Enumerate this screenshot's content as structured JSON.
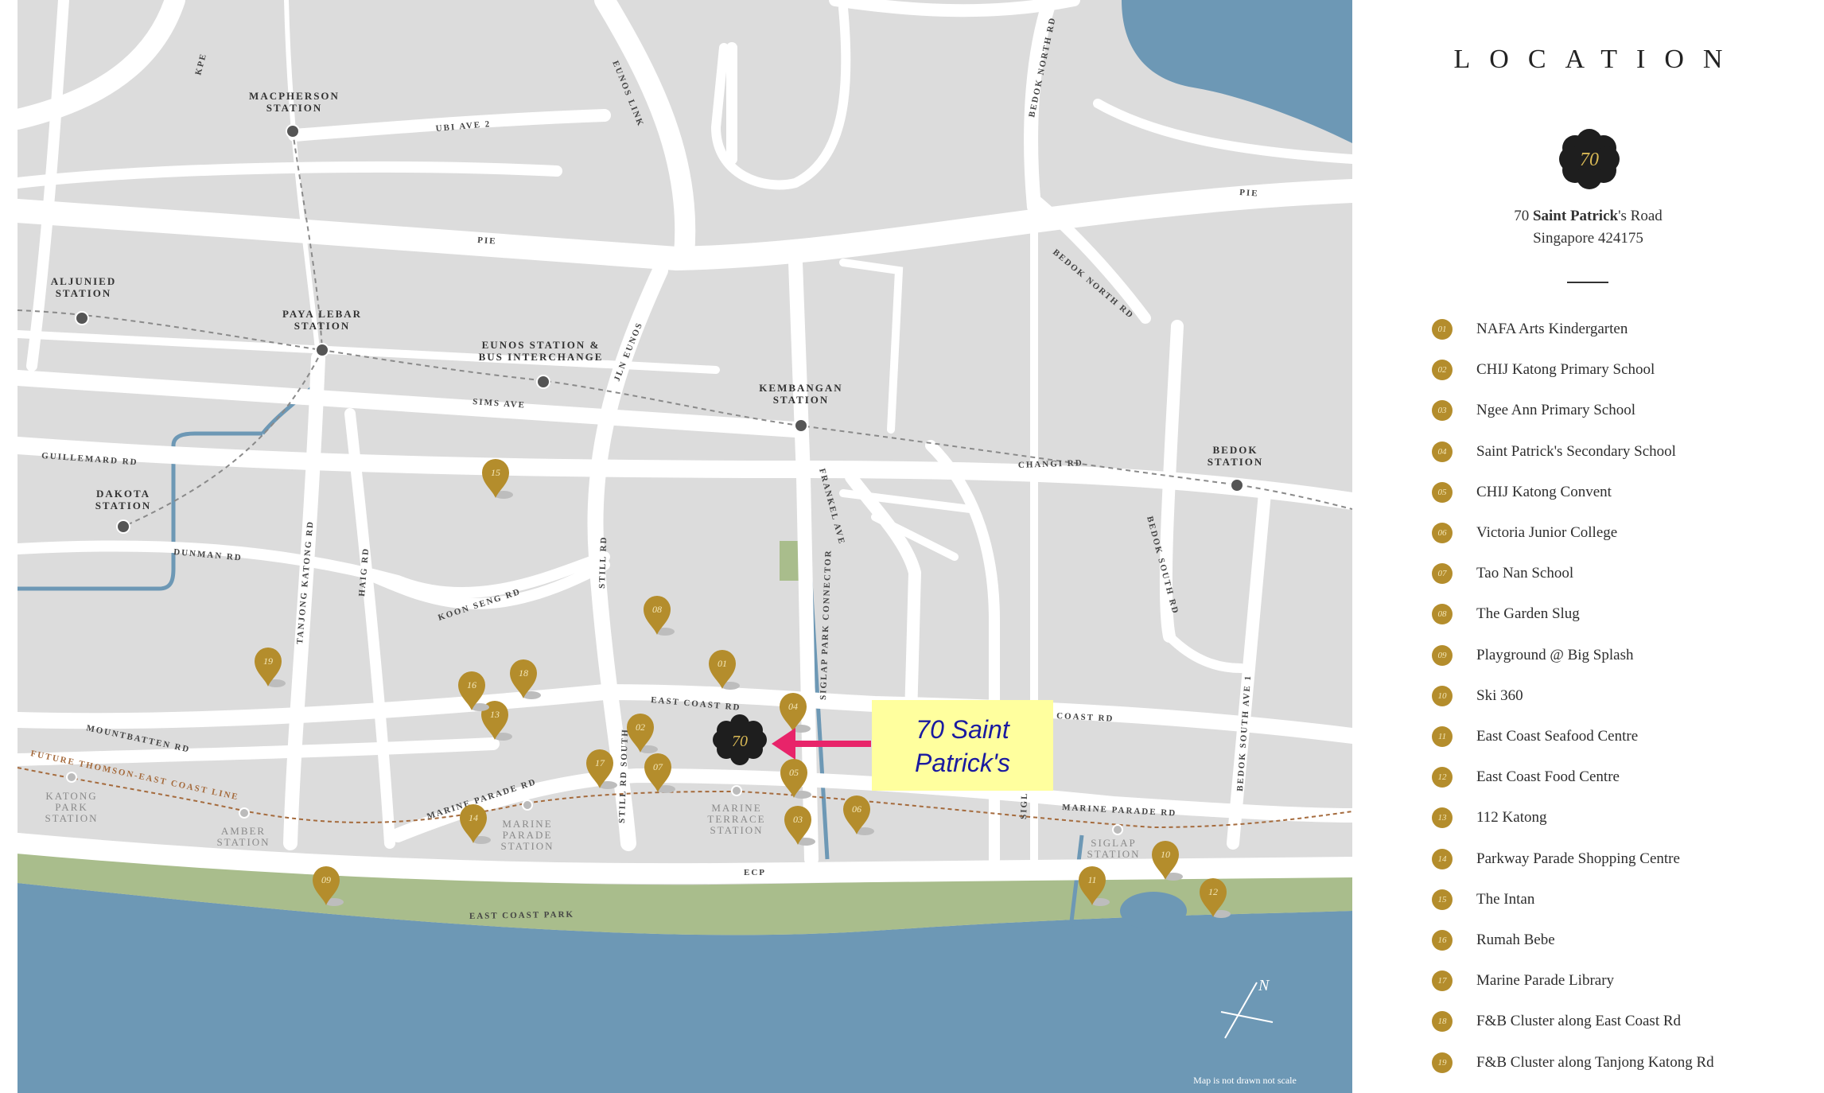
{
  "panel": {
    "title": "LOCATION",
    "logo_text": "70",
    "address_prefix": "70 ",
    "address_bold": "Saint Patrick",
    "address_rest": "'s Road",
    "address_line2": "Singapore 424175"
  },
  "legend": [
    {
      "num": "01",
      "label": "NAFA Arts Kindergarten"
    },
    {
      "num": "02",
      "label": "CHIJ Katong Primary School"
    },
    {
      "num": "03",
      "label": "Ngee Ann Primary School"
    },
    {
      "num": "04",
      "label": "Saint Patrick's Secondary School"
    },
    {
      "num": "05",
      "label": "CHIJ Katong Convent"
    },
    {
      "num": "06",
      "label": "Victoria Junior College"
    },
    {
      "num": "07",
      "label": "Tao Nan School"
    },
    {
      "num": "08",
      "label": "The Garden Slug"
    },
    {
      "num": "09",
      "label": "Playground @ Big Splash"
    },
    {
      "num": "10",
      "label": "Ski 360"
    },
    {
      "num": "11",
      "label": "East Coast Seafood Centre"
    },
    {
      "num": "12",
      "label": "East Coast Food Centre"
    },
    {
      "num": "13",
      "label": "112 Katong"
    },
    {
      "num": "14",
      "label": "Parkway Parade Shopping Centre"
    },
    {
      "num": "15",
      "label": "The Intan"
    },
    {
      "num": "16",
      "label": "Rumah Bebe"
    },
    {
      "num": "17",
      "label": "Marine Parade Library"
    },
    {
      "num": "18",
      "label": "F&B Cluster along East Coast Rd"
    },
    {
      "num": "19",
      "label": "F&B Cluster along Tanjong Katong Rd"
    }
  ],
  "stations": {
    "macpherson": [
      "MACPHERSON",
      "STATION"
    ],
    "aljunied": [
      "ALJUNIED",
      "STATION"
    ],
    "paya_lebar": [
      "PAYA LEBAR",
      "STATION"
    ],
    "eunos": [
      "EUNOS STATION &",
      "BUS INTERCHANGE"
    ],
    "kembangan": [
      "KEMBANGAN",
      "STATION"
    ],
    "bedok": [
      "BEDOK",
      "STATION"
    ],
    "dakota": [
      "DAKOTA",
      "STATION"
    ],
    "katong_park": [
      "KATONG",
      "PARK",
      "STATION"
    ],
    "amber": [
      "AMBER",
      "STATION"
    ],
    "marine_parade": [
      "MARINE",
      "PARADE",
      "STATION"
    ],
    "marine_terrace": [
      "MARINE",
      "TERRACE",
      "STATION"
    ],
    "siglap": [
      "SIGLAP",
      "STATION"
    ]
  },
  "roads": {
    "kpe": "KPE",
    "ubi_ave_2": "UBI AVE 2",
    "eunos_link": "EUNOS LINK",
    "bedok_north_rd_top": "BEDOK NORTH RD",
    "pie_left": "PIE",
    "pie_right": "PIE",
    "bedok_north_rd": "BEDOK NORTH RD",
    "jln_eunos": "JLN EUNOS",
    "sims_ave": "SIMS AVE",
    "guillemard_rd": "GUILLEMARD RD",
    "changi_rd": "CHANGI RD",
    "dunman_rd": "DUNMAN RD",
    "tanjong_katong_rd": "TANJONG KATONG RD",
    "haig_rd": "HAIG RD",
    "koon_seng_rd": "KOON SENG RD",
    "still_rd": "STILL RD",
    "frankel_ave": "FRANKEL AVE",
    "siglap_park_connector": "SIGLAP PARK CONNECTOR",
    "bedok_south_rd": "BEDOK SOUTH RD",
    "bedok_south_ave_1": "BEDOK SOUTH AVE 1",
    "east_coast_rd": "EAST COAST RD",
    "coast_rd": "COAST RD",
    "mountbatten_rd": "MOUNTBATTEN RD",
    "marine_parade_rd_left": "MARINE PARADE RD",
    "marine_parade_rd_right": "MARINE PARADE RD",
    "still_rd_south": "STILL RD SOUTH",
    "sigl": "SIGL",
    "ecp": "ECP",
    "east_coast_park": "EAST COAST PARK",
    "future_line": "FUTURE THOMSON-EAST COAST LINE"
  },
  "callout": {
    "line1": "70 Saint",
    "line2": "Patrick's",
    "marker_text": "70"
  },
  "compass": "N",
  "note": "Map is not drawn not scale",
  "colors": {
    "land": "#dcdcdc",
    "road": "#ffffff",
    "sea": "#6d98b5",
    "park": "#a9bd8c",
    "pin": "#b48d2c",
    "callout_bg": "#ffff9e",
    "arrow": "#e8246a",
    "future_line": "#a56b3d"
  },
  "map_pins": [
    {
      "num": "01"
    },
    {
      "num": "02"
    },
    {
      "num": "03"
    },
    {
      "num": "04"
    },
    {
      "num": "05"
    },
    {
      "num": "06"
    },
    {
      "num": "07"
    },
    {
      "num": "08"
    },
    {
      "num": "09"
    },
    {
      "num": "10"
    },
    {
      "num": "11"
    },
    {
      "num": "12"
    },
    {
      "num": "13"
    },
    {
      "num": "14"
    },
    {
      "num": "15"
    },
    {
      "num": "16"
    },
    {
      "num": "17"
    },
    {
      "num": "18"
    },
    {
      "num": "19"
    }
  ]
}
